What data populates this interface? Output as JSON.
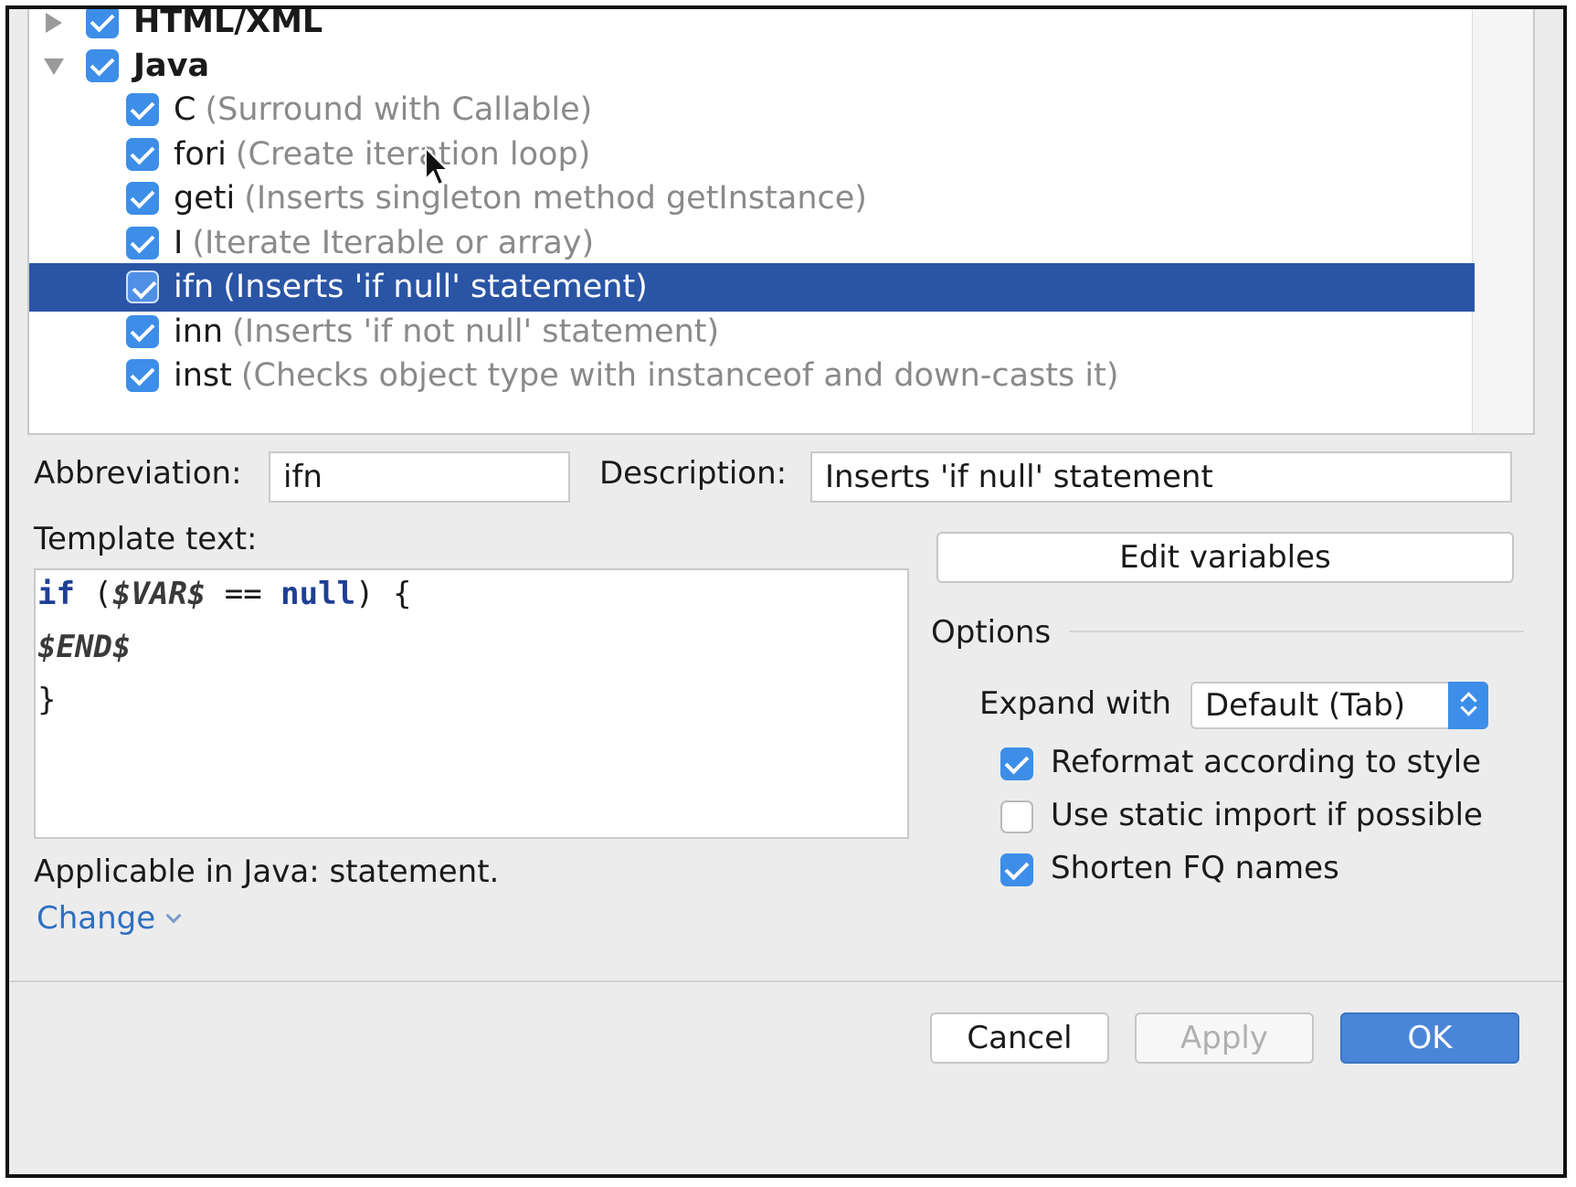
{
  "tree": {
    "groups": [
      {
        "label": "HTML/XML",
        "checked": true,
        "expanded": false
      },
      {
        "label": "Java",
        "checked": true,
        "expanded": true
      }
    ],
    "items": [
      {
        "abbr": "C",
        "desc": "(Surround with Callable)",
        "checked": true
      },
      {
        "abbr": "fori",
        "desc": "(Create iteration loop)",
        "checked": true
      },
      {
        "abbr": "geti",
        "desc": "(Inserts singleton method getInstance)",
        "checked": true
      },
      {
        "abbr": "I",
        "desc": "(Iterate Iterable or array)",
        "checked": true
      },
      {
        "abbr": "ifn",
        "desc": "(Inserts 'if null' statement)",
        "checked": true,
        "selected": true
      },
      {
        "abbr": "inn",
        "desc": "(Inserts 'if not null' statement)",
        "checked": true
      },
      {
        "abbr": "inst",
        "desc": "(Checks object type with instanceof and down-casts it)",
        "checked": true
      }
    ]
  },
  "form": {
    "abbreviation_label": "Abbreviation:",
    "abbreviation_value": "ifn",
    "description_label": "Description:",
    "description_value": "Inserts 'if null' statement",
    "template_label": "Template text:",
    "template_lines": {
      "l1_kw_if": "if",
      "l1_open": " (",
      "l1_var": "$VAR$",
      "l1_eq": " == ",
      "l1_kw_null": "null",
      "l1_close": ") {",
      "l2_var": "$END$",
      "l3": "}"
    },
    "applicable_text": "Applicable in Java: statement.",
    "change_link": "Change"
  },
  "options": {
    "edit_variables_label": "Edit variables",
    "section_title": "Options",
    "expand_with_label": "Expand with",
    "expand_with_value": "Default (Tab)",
    "checkboxes": [
      {
        "label": "Reformat according to style",
        "checked": true
      },
      {
        "label": "Use static import if possible",
        "checked": false
      },
      {
        "label": "Shorten FQ names",
        "checked": true
      }
    ]
  },
  "footer": {
    "cancel_label": "Cancel",
    "apply_label": "Apply",
    "ok_label": "OK"
  },
  "colors": {
    "selection": "#2a55a5",
    "checkbox": "#3d8ee8",
    "link": "#2f6fc0",
    "primary_button": "#4a86d8"
  }
}
